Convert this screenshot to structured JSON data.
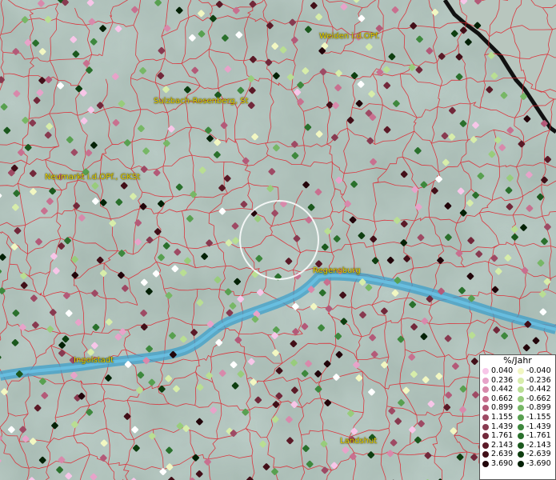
{
  "map": {
    "cities": [
      {
        "name": "Weiden i.d.OPf."
      },
      {
        "name": "Sulzbach-Rosenberg, St"
      },
      {
        "name": "Neumarkt i.d.OPf., GKSt"
      },
      {
        "name": "Regensburg"
      },
      {
        "name": "Ingolstadt"
      },
      {
        "name": "Landshut"
      }
    ]
  },
  "legend": {
    "title": "%/Jahr",
    "positive_labels": [
      "0.040",
      "0.236",
      "0.442",
      "0.662",
      "0.899",
      "1.155",
      "1.439",
      "1.761",
      "2.143",
      "2.639",
      "3.690"
    ],
    "negative_labels": [
      "-0.040",
      "-0.236",
      "-0.442",
      "-0.662",
      "-0.899",
      "-1.155",
      "-1.439",
      "-1.761",
      "-2.143",
      "-2.639",
      "-3.690"
    ],
    "positive_colors": [
      "#f7c6e8",
      "#e7a3c9",
      "#d889ab",
      "#c8708f",
      "#b35a78",
      "#9e4a64",
      "#883a50",
      "#72283a",
      "#5b1a27",
      "#420f18",
      "#22050a"
    ],
    "negative_colors": [
      "#f2f7c2",
      "#d7edaa",
      "#b9de93",
      "#98cc7c",
      "#77b766",
      "#58a050",
      "#3e883d",
      "#2a702c",
      "#1b581d",
      "#0e3e10",
      "#042106"
    ]
  }
}
